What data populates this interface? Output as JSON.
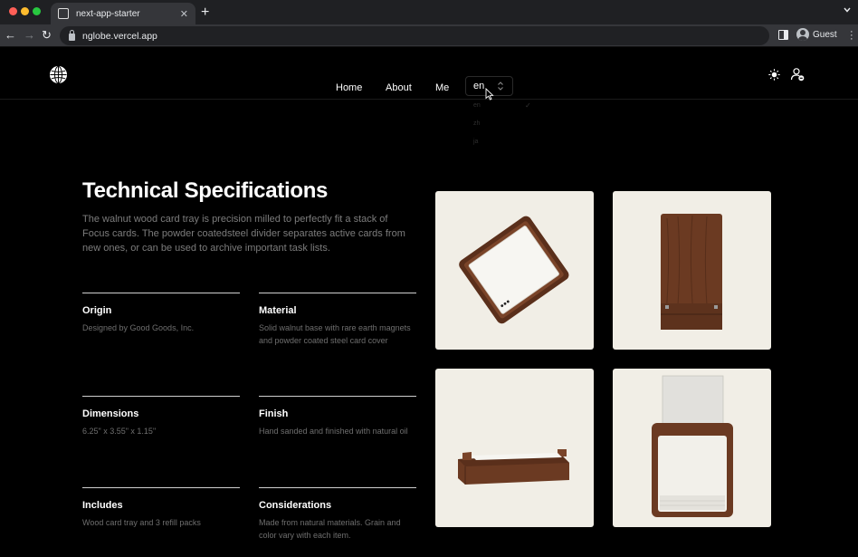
{
  "browser": {
    "tab_title": "next-app-starter",
    "url": "nglobe.vercel.app",
    "profile_name": "Guest"
  },
  "site": {
    "nav": [
      {
        "label": "Home"
      },
      {
        "label": "About"
      },
      {
        "label": "Me"
      }
    ],
    "language": {
      "selected": "en",
      "options": [
        "en",
        "zh",
        "ja"
      ]
    }
  },
  "content": {
    "title": "Technical Specifications",
    "intro": "The walnut wood card tray is precision milled to perfectly fit a stack of Focus cards. The powder coatedsteel divider separates active cards from new ones, or can be used to archive important task lists.",
    "specs": [
      {
        "label": "Origin",
        "value": "Designed by Good Goods, Inc."
      },
      {
        "label": "Material",
        "value": "Solid walnut base with rare earth magnets and powder coated steel card cover"
      },
      {
        "label": "Dimensions",
        "value": "6.25\" x 3.55\" x 1.15\""
      },
      {
        "label": "Finish",
        "value": "Hand sanded and finished with natural oil"
      },
      {
        "label": "Includes",
        "value": "Wood card tray and 3 refill packs"
      },
      {
        "label": "Considerations",
        "value": "Made from natural materials. Grain and color vary with each item."
      }
    ]
  },
  "colors": {
    "page_bg": "#000000",
    "photo_bg": "#f1eee6",
    "walnut": "#6b3a22",
    "muted_text": "#7c7c7c"
  }
}
